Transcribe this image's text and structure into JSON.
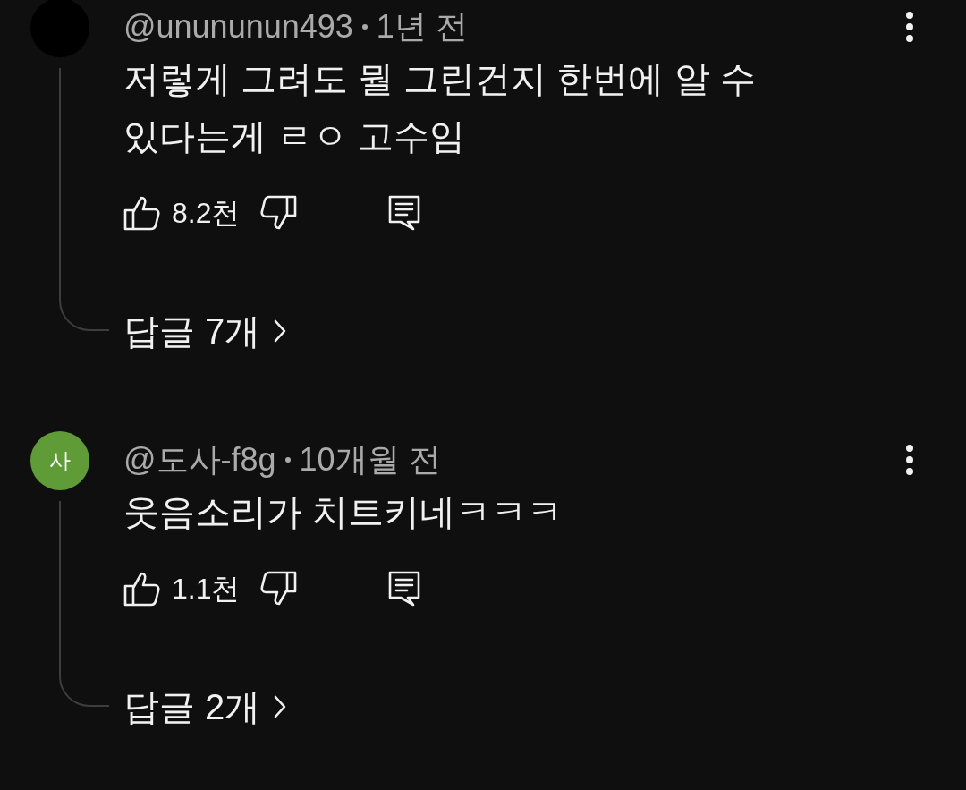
{
  "comments": [
    {
      "author": "@unununun493",
      "time": "1년 전",
      "avatar": {
        "color": "#000000"
      },
      "text": "저렇게 그려도 뭘 그린건지 한번에 알 수 있다는게 ㄹㅇ 고수임",
      "likes": "8.2천",
      "replies": "답글 7개"
    },
    {
      "author": "@도사-f8g",
      "time": "10개월 전",
      "avatar": {
        "color": "#5f9b37",
        "letter": "사"
      },
      "text": "웃음소리가 치트키네ㅋㅋㅋ",
      "likes": "1.1천",
      "replies": "답글 2개"
    }
  ]
}
